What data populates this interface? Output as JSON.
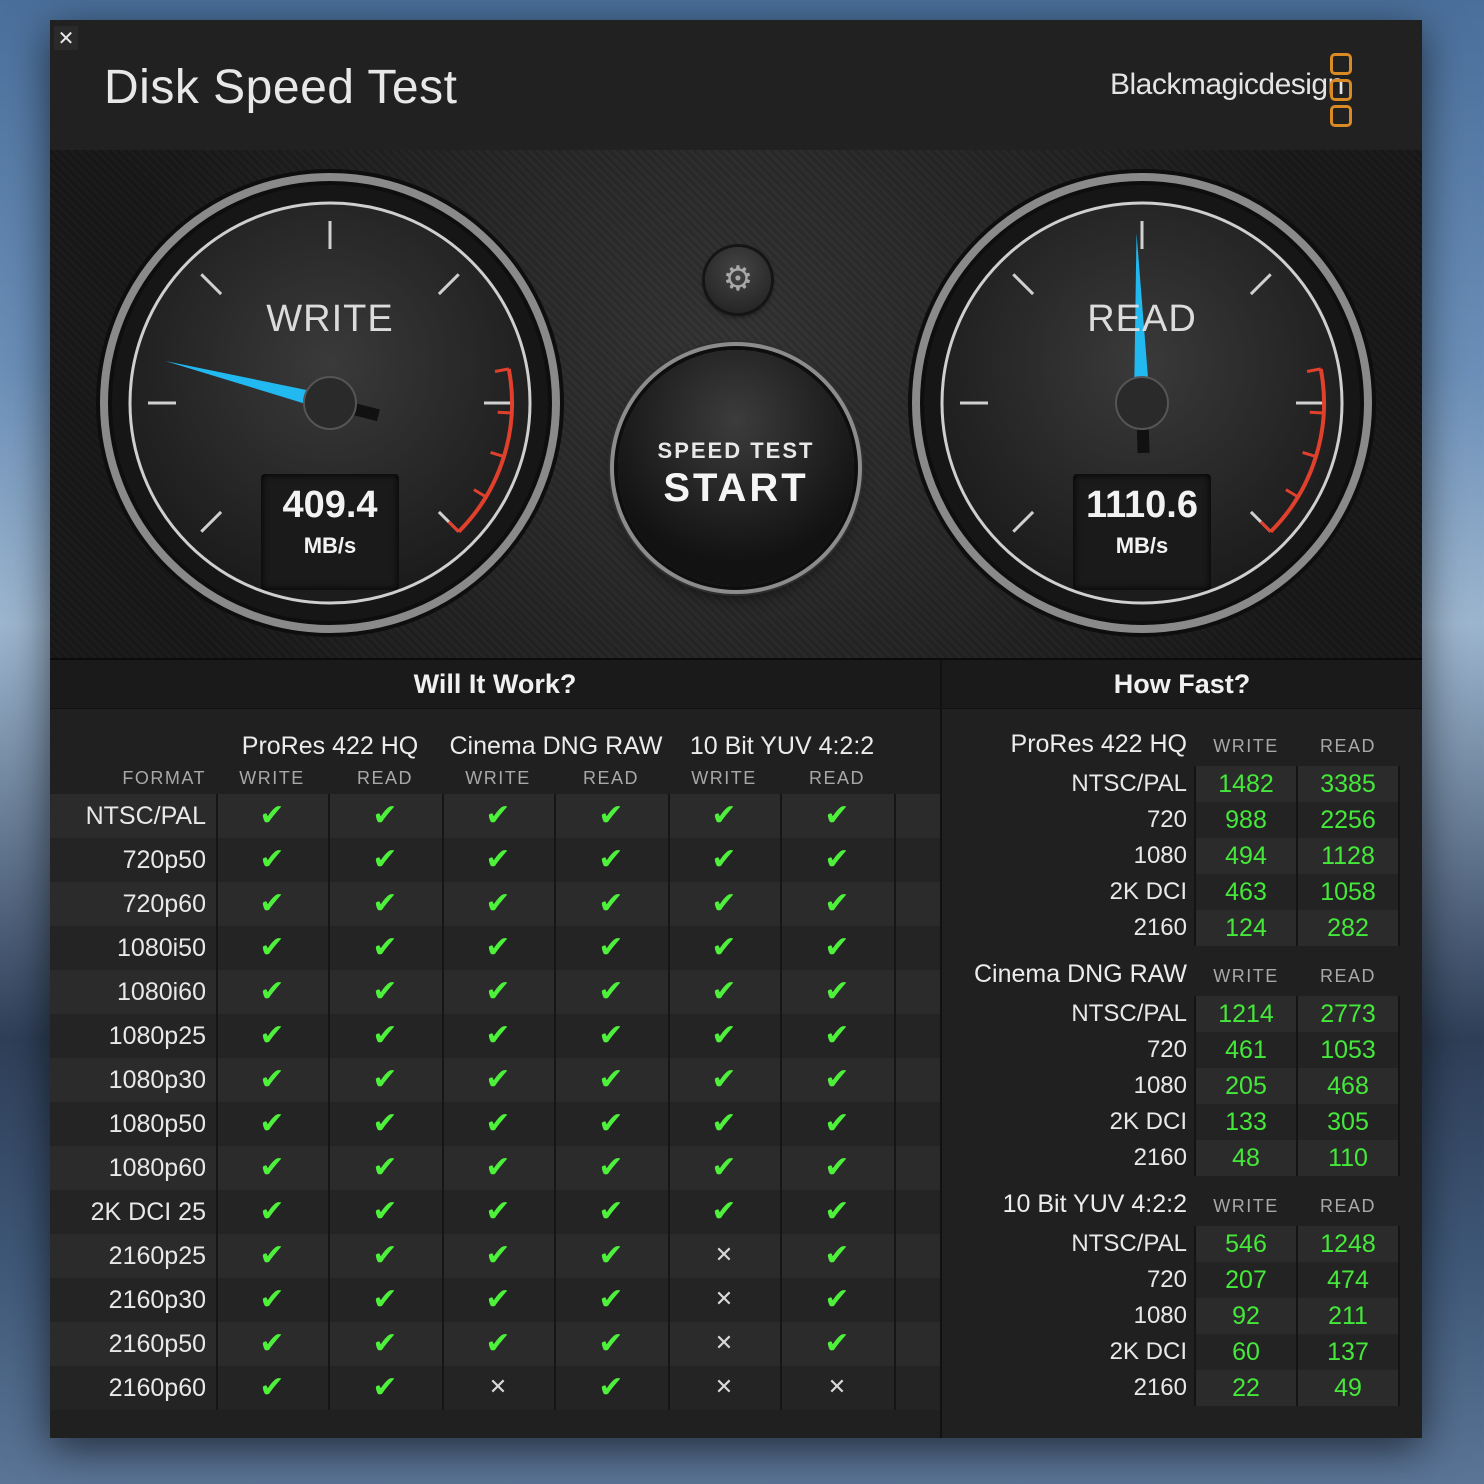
{
  "app": {
    "title": "Disk Speed Test",
    "brand": "Blackmagicdesign",
    "close_icon": "close-icon"
  },
  "gauges": {
    "write": {
      "label": "WRITE",
      "value": "409.4",
      "unit": "MB/s",
      "needle_value_mbps": 409.4
    },
    "read": {
      "label": "READ",
      "value": "1110.6",
      "unit": "MB/s",
      "needle_value_mbps": 1110.6
    },
    "accent_color": "#22b8f0",
    "redline_color": "#e0402c"
  },
  "controls": {
    "settings_icon": "gear-icon",
    "start_line1": "SPEED TEST",
    "start_line2": "START"
  },
  "will_it_work": {
    "title": "Will It Work?",
    "format_label": "FORMAT",
    "groups": [
      "ProRes 422 HQ",
      "Cinema DNG RAW",
      "10 Bit YUV 4:2:2"
    ],
    "col_labels": [
      "WRITE",
      "READ",
      "WRITE",
      "READ",
      "WRITE",
      "READ"
    ],
    "rows": [
      {
        "format": "NTSC/PAL",
        "cells": [
          true,
          true,
          true,
          true,
          true,
          true
        ]
      },
      {
        "format": "720p50",
        "cells": [
          true,
          true,
          true,
          true,
          true,
          true
        ]
      },
      {
        "format": "720p60",
        "cells": [
          true,
          true,
          true,
          true,
          true,
          true
        ]
      },
      {
        "format": "1080i50",
        "cells": [
          true,
          true,
          true,
          true,
          true,
          true
        ]
      },
      {
        "format": "1080i60",
        "cells": [
          true,
          true,
          true,
          true,
          true,
          true
        ]
      },
      {
        "format": "1080p25",
        "cells": [
          true,
          true,
          true,
          true,
          true,
          true
        ]
      },
      {
        "format": "1080p30",
        "cells": [
          true,
          true,
          true,
          true,
          true,
          true
        ]
      },
      {
        "format": "1080p50",
        "cells": [
          true,
          true,
          true,
          true,
          true,
          true
        ]
      },
      {
        "format": "1080p60",
        "cells": [
          true,
          true,
          true,
          true,
          true,
          true
        ]
      },
      {
        "format": "2K DCI 25",
        "cells": [
          true,
          true,
          true,
          true,
          true,
          true
        ]
      },
      {
        "format": "2160p25",
        "cells": [
          true,
          true,
          true,
          true,
          false,
          true
        ]
      },
      {
        "format": "2160p30",
        "cells": [
          true,
          true,
          true,
          true,
          false,
          true
        ]
      },
      {
        "format": "2160p50",
        "cells": [
          true,
          true,
          true,
          true,
          false,
          true
        ]
      },
      {
        "format": "2160p60",
        "cells": [
          true,
          true,
          false,
          true,
          false,
          false
        ]
      }
    ],
    "ok_symbol": "✔",
    "no_symbol": "✕"
  },
  "how_fast": {
    "title": "How Fast?",
    "groups": [
      {
        "name": "ProRes 422 HQ",
        "write_label": "WRITE",
        "read_label": "READ",
        "rows": [
          {
            "label": "NTSC/PAL",
            "write": "1482",
            "read": "3385"
          },
          {
            "label": "720",
            "write": "988",
            "read": "2256"
          },
          {
            "label": "1080",
            "write": "494",
            "read": "1128"
          },
          {
            "label": "2K DCI",
            "write": "463",
            "read": "1058"
          },
          {
            "label": "2160",
            "write": "124",
            "read": "282"
          }
        ]
      },
      {
        "name": "Cinema DNG RAW",
        "write_label": "WRITE",
        "read_label": "READ",
        "rows": [
          {
            "label": "NTSC/PAL",
            "write": "1214",
            "read": "2773"
          },
          {
            "label": "720",
            "write": "461",
            "read": "1053"
          },
          {
            "label": "1080",
            "write": "205",
            "read": "468"
          },
          {
            "label": "2K DCI",
            "write": "133",
            "read": "305"
          },
          {
            "label": "2160",
            "write": "48",
            "read": "110"
          }
        ]
      },
      {
        "name": "10 Bit YUV 4:2:2",
        "write_label": "WRITE",
        "read_label": "READ",
        "rows": [
          {
            "label": "NTSC/PAL",
            "write": "546",
            "read": "1248"
          },
          {
            "label": "720",
            "write": "207",
            "read": "474"
          },
          {
            "label": "1080",
            "write": "92",
            "read": "211"
          },
          {
            "label": "2K DCI",
            "write": "60",
            "read": "137"
          },
          {
            "label": "2160",
            "write": "22",
            "read": "49"
          }
        ]
      }
    ]
  }
}
